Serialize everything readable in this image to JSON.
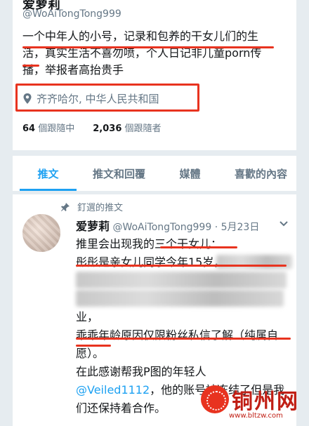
{
  "profile": {
    "name": "爱萝莉",
    "handle": "@WoAiTongTong999",
    "bio_lines": [
      "一个中年人的小号，记录和包养的干女儿们的生",
      "活，真实生活不喜勿喷，个人日记非儿童porn传",
      "播，举报者高抬贵手"
    ],
    "location": "齐齐哈尔, 中华人民共和国",
    "following_count": "64",
    "following_label": "個跟隨中",
    "followers_count": "2,036",
    "followers_label": "個跟隨者"
  },
  "tabs": [
    {
      "label": "推文",
      "active": true
    },
    {
      "label": "推文和回覆",
      "active": false
    },
    {
      "label": "媒體",
      "active": false
    },
    {
      "label": "喜歡的內容",
      "active": false
    }
  ],
  "tweet": {
    "pinned_label": "釘選的推文",
    "author": "爱萝莉",
    "handle": "@WoAiTongTong999",
    "date": "· 5月23日",
    "lines": [
      "推里会出现我的三个干女儿：",
      "彤彤是亲女儿同学今年15岁，",
      "",
      "",
      "业，",
      "乖乖年龄原因仅限粉丝私信了解（纯属自",
      "愿）。",
      "在此感谢帮我P图的年轻人",
      "",
      "们还保持着合作。"
    ],
    "mention": "@Veiled1112",
    "mention_rest": "，他的账号被冻结了但是我"
  },
  "watermark": {
    "text": "铜州网",
    "url": "www.bltzw.com"
  },
  "colors": {
    "accent": "#1da1f2",
    "highlight": "#e8331f",
    "muted": "#657786"
  }
}
